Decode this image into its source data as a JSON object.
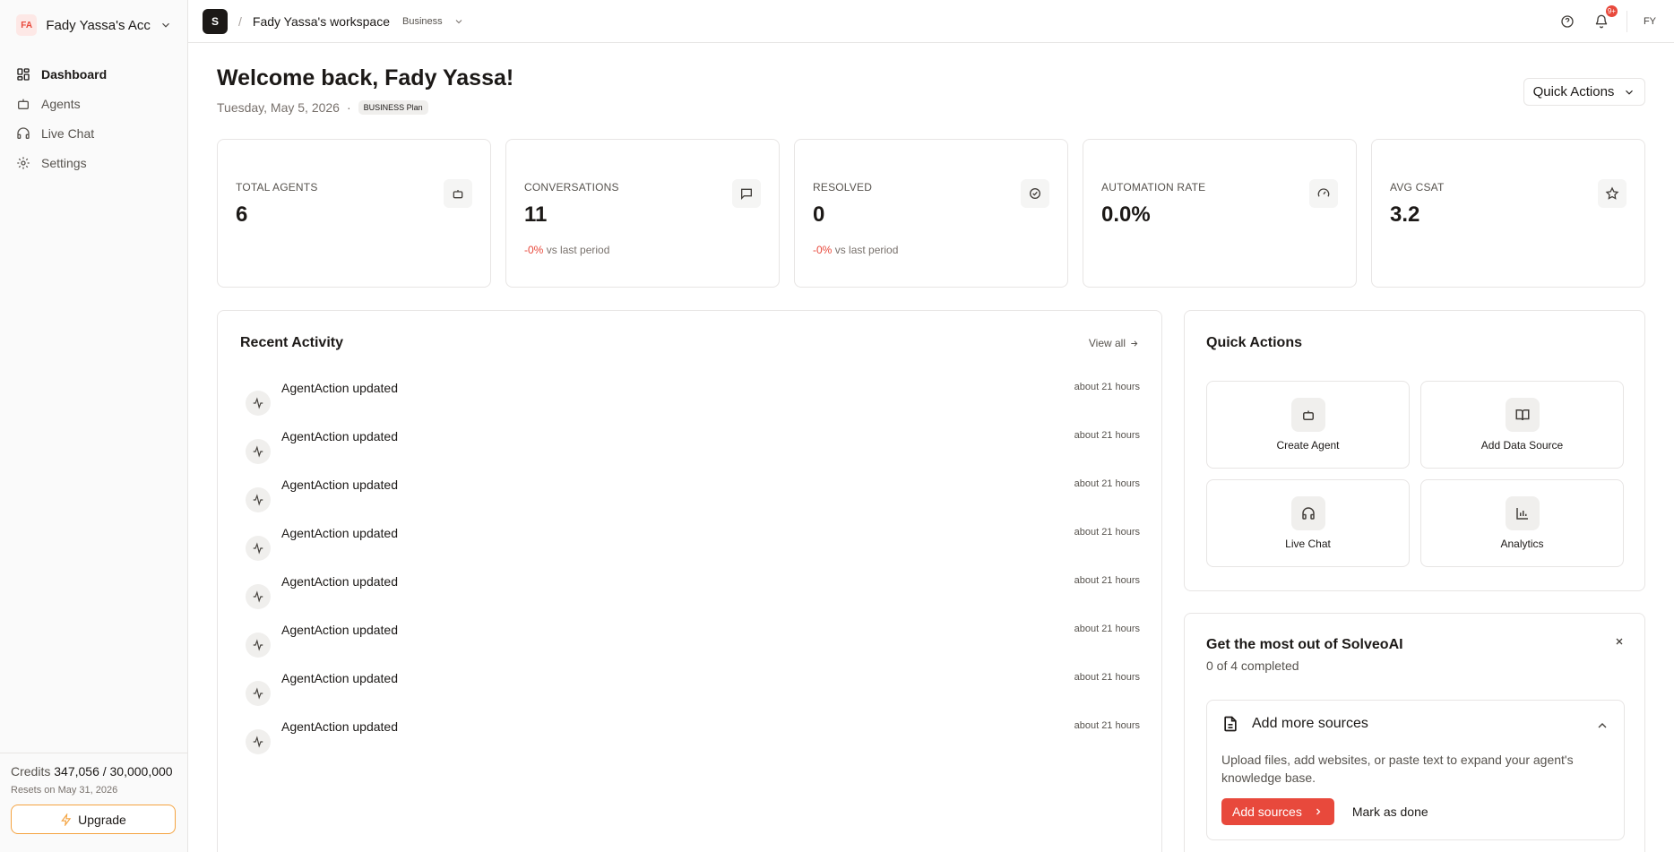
{
  "sidebar": {
    "account_initials": "FA",
    "account_name": "Fady Yassa's Acco...",
    "nav": [
      {
        "label": "Dashboard",
        "icon": "dashboard-icon",
        "active": true
      },
      {
        "label": "Agents",
        "icon": "bot-icon",
        "active": false
      },
      {
        "label": "Live Chat",
        "icon": "headset-icon",
        "active": false
      },
      {
        "label": "Settings",
        "icon": "gear-icon",
        "active": false
      }
    ],
    "credits_label": "Credits",
    "credits_value": "347,056 / 30,000,000",
    "resets": "Resets on May 31, 2026",
    "upgrade_label": "Upgrade"
  },
  "topbar": {
    "workspace_initial": "S",
    "separator": "/",
    "workspace_name": "Fady Yassa's workspace",
    "workspace_plan": "Business",
    "notification_count": "9+",
    "user_initials": "FY"
  },
  "main": {
    "title": "Welcome back, Fady Yassa!",
    "date": "Tuesday, May 5, 2026",
    "dot": "·",
    "plan_badge": "BUSINESS Plan",
    "quick_actions_button": "Quick Actions",
    "stats": [
      {
        "label": "TOTAL AGENTS",
        "value": "6",
        "delta": "",
        "delta_suffix": "",
        "icon": "bot-icon"
      },
      {
        "label": "CONVERSATIONS",
        "value": "11",
        "delta": "-0%",
        "delta_suffix": "vs last period",
        "icon": "message-square-icon"
      },
      {
        "label": "RESOLVED",
        "value": "0",
        "delta": "-0%",
        "delta_suffix": "vs last period",
        "icon": "check-circle-icon"
      },
      {
        "label": "AUTOMATION RATE",
        "value": "0.0%",
        "delta": "",
        "delta_suffix": "",
        "icon": "gauge-icon"
      },
      {
        "label": "AVG CSAT",
        "value": "3.2",
        "delta": "",
        "delta_suffix": "",
        "icon": "star-icon"
      }
    ],
    "recent_activity": {
      "title": "Recent Activity",
      "view_all": "View all",
      "items": [
        {
          "text": "AgentAction updated",
          "time": "about 21 hours"
        },
        {
          "text": "AgentAction updated",
          "time": "about 21 hours"
        },
        {
          "text": "AgentAction updated",
          "time": "about 21 hours"
        },
        {
          "text": "AgentAction updated",
          "time": "about 21 hours"
        },
        {
          "text": "AgentAction updated",
          "time": "about 21 hours"
        },
        {
          "text": "AgentAction updated",
          "time": "about 21 hours"
        },
        {
          "text": "AgentAction updated",
          "time": "about 21 hours"
        },
        {
          "text": "AgentAction updated",
          "time": "about 21 hours"
        }
      ]
    },
    "quick_actions": {
      "title": "Quick Actions",
      "tiles": [
        {
          "label": "Create Agent",
          "icon": "bot-icon"
        },
        {
          "label": "Add Data Source",
          "icon": "book-open-icon"
        },
        {
          "label": "Live Chat",
          "icon": "headset-icon"
        },
        {
          "label": "Analytics",
          "icon": "bar-chart-icon"
        }
      ]
    },
    "onboarding": {
      "title": "Get the most out of SolveoAI",
      "progress": "0 of 4 completed",
      "step": {
        "title": "Add more sources",
        "description": "Upload files, add websites, or paste text to expand your agent's knowledge base.",
        "primary": "Add sources",
        "secondary": "Mark as done"
      }
    }
  },
  "colors": {
    "accent": "#e8493c",
    "upgrade_border": "#f4a340",
    "border": "#e7e5e4",
    "sidebar_bg": "#fafafa"
  }
}
